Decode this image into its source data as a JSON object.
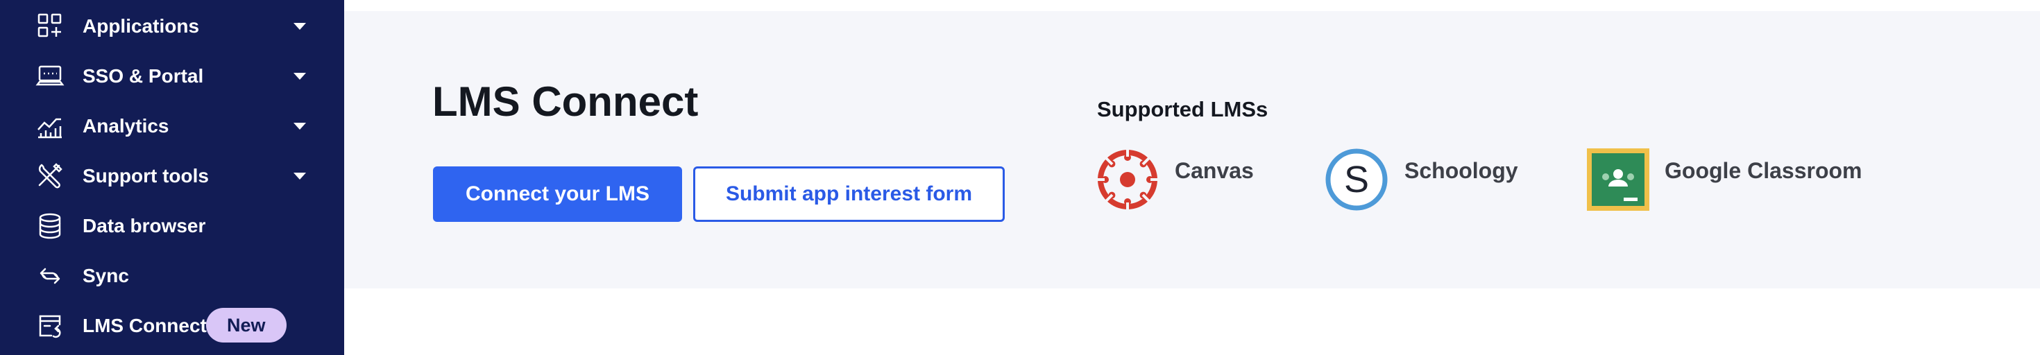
{
  "sidebar": {
    "items": [
      {
        "label": "Applications",
        "icon": "grid-plus-icon",
        "has_caret": true
      },
      {
        "label": "SSO & Portal",
        "icon": "monitor-icon",
        "has_caret": true
      },
      {
        "label": "Analytics",
        "icon": "line-chart-icon",
        "has_caret": true
      },
      {
        "label": "Support tools",
        "icon": "tools-icon",
        "has_caret": true
      },
      {
        "label": "Data browser",
        "icon": "database-icon",
        "has_caret": false
      },
      {
        "label": "Sync",
        "icon": "sync-icon",
        "has_caret": false
      },
      {
        "label": "LMS Connect",
        "icon": "lms-window-icon",
        "has_caret": false,
        "badge": "New"
      }
    ]
  },
  "main": {
    "title": "LMS Connect",
    "buttons": {
      "connect": "Connect your LMS",
      "submit": "Submit app interest form"
    },
    "supported": {
      "heading": "Supported LMSs",
      "items": [
        {
          "name": "Canvas",
          "icon": "canvas-logo-icon"
        },
        {
          "name": "Schoology",
          "icon": "schoology-logo-icon"
        },
        {
          "name": "Google Classroom",
          "icon": "google-classroom-logo-icon"
        }
      ]
    }
  },
  "colors": {
    "sidebar_bg": "#121c55",
    "primary": "#2f64f0",
    "badge_bg": "#d9c6f7",
    "panel_bg": "#f5f6fa",
    "canvas_red": "#d63b2f",
    "schoology_blue": "#4d9ad8",
    "classroom_green": "#2e8b57",
    "classroom_yellow": "#f0c04a"
  }
}
